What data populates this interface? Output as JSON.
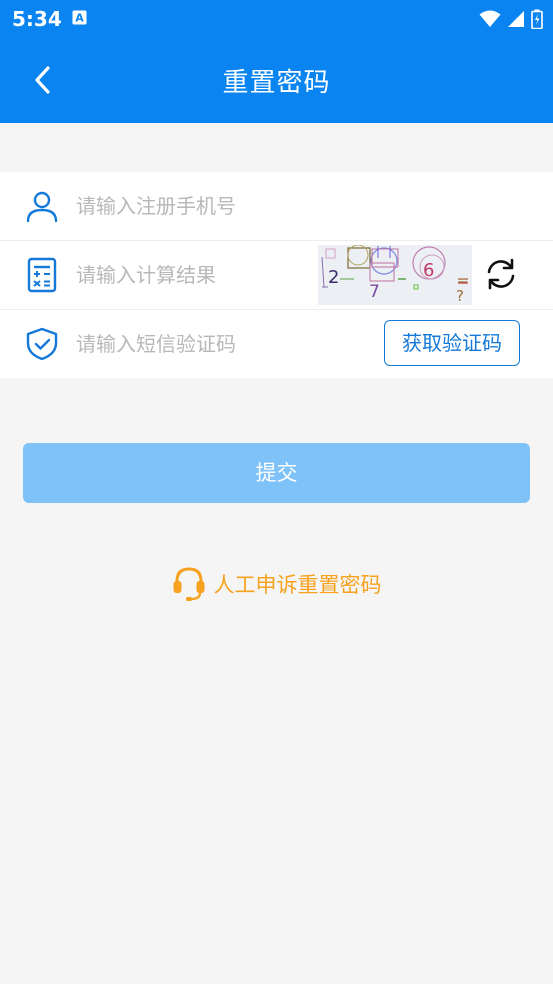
{
  "status_bar": {
    "time": "5:34"
  },
  "app_bar": {
    "title": "重置密码"
  },
  "form": {
    "phone_placeholder": "请输入注册手机号",
    "calc_placeholder": "请输入计算结果",
    "captcha_chars": [
      "2",
      "7",
      "6",
      "=",
      "?"
    ],
    "sms_placeholder": "请输入短信验证码",
    "get_code_label": "获取验证码"
  },
  "submit_label": "提交",
  "appeal_label": "人工申诉重置密码",
  "colors": {
    "primary": "#0a84f0",
    "submit_disabled": "#7fc2f8",
    "appeal": "#f6a21e",
    "icon_blue": "#1479d8"
  },
  "icons": {
    "status": [
      "keyboard-a-icon",
      "wifi-icon",
      "signal-icon",
      "battery-icon"
    ],
    "back": "chevron-left-icon",
    "phone_row": "user-icon",
    "calc_row": "calculator-icon",
    "sms_row": "shield-check-icon",
    "captcha_refresh": "refresh-icon",
    "appeal": "headset-icon"
  }
}
